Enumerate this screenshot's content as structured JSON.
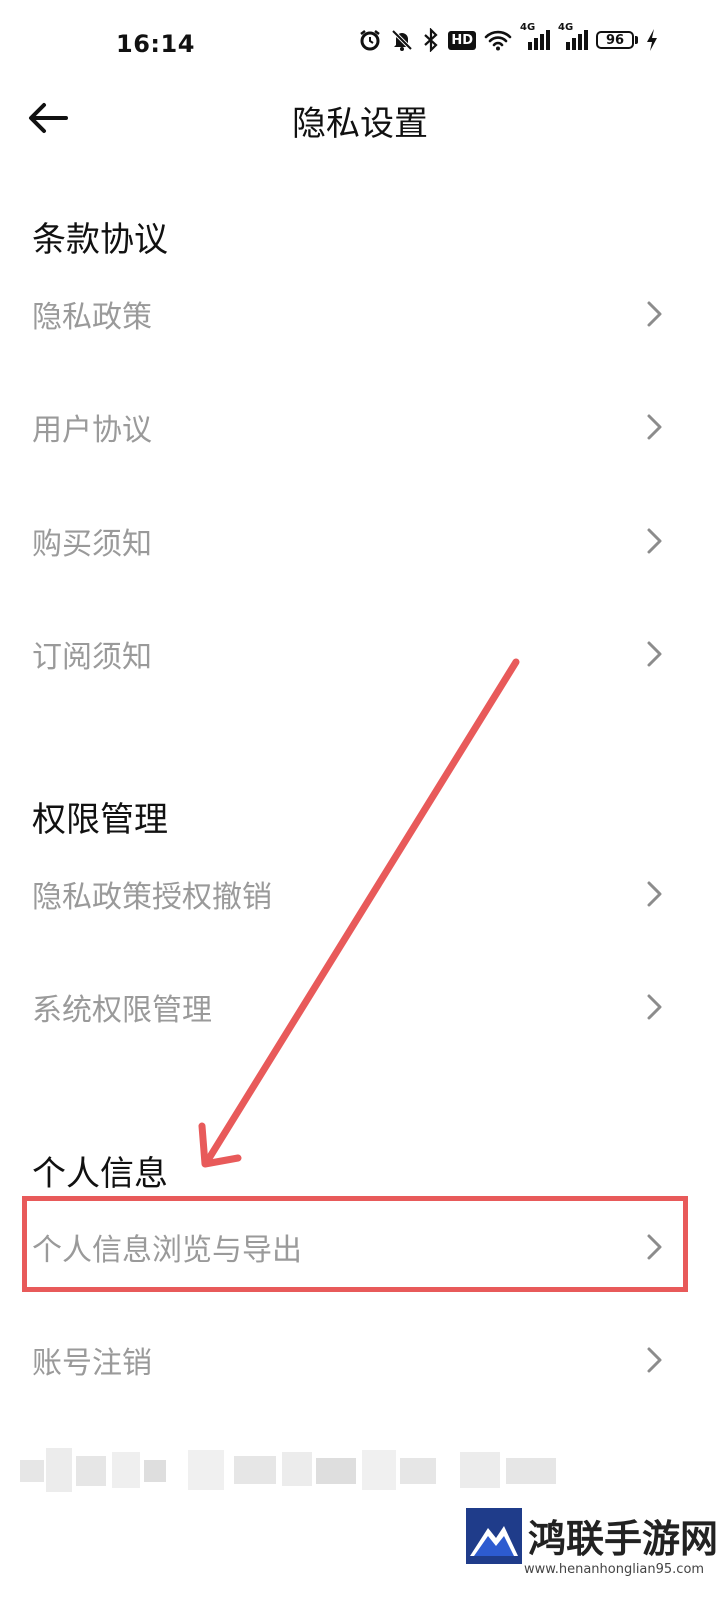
{
  "status_bar": {
    "time": "16:14",
    "icons": [
      "alarm-icon",
      "bell-off-icon",
      "bluetooth-icon",
      "hd-icon",
      "wifi-icon",
      "signal-4g-icon",
      "signal-4g-icon",
      "battery-icon",
      "charging-icon"
    ],
    "hd_label": "HD",
    "net_label_1": "4G",
    "net_label_2": "4G",
    "battery_level": "96"
  },
  "top_bar": {
    "title": "隐私设置"
  },
  "sections": [
    {
      "header": "条款协议",
      "items": [
        "隐私政策",
        "用户协议",
        "购买须知",
        "订阅须知"
      ]
    },
    {
      "header": "权限管理",
      "items": [
        "隐私政策授权撤销",
        "系统权限管理"
      ]
    },
    {
      "header": "个人信息",
      "items": [
        "个人信息浏览与导出",
        "账号注销"
      ]
    }
  ],
  "annotation": {
    "color": "#e85a5a",
    "highlighted_item": "个人信息浏览与导出"
  },
  "watermark": {
    "title": "鸿联手游网",
    "url": "www.henanhonglian95.com"
  }
}
